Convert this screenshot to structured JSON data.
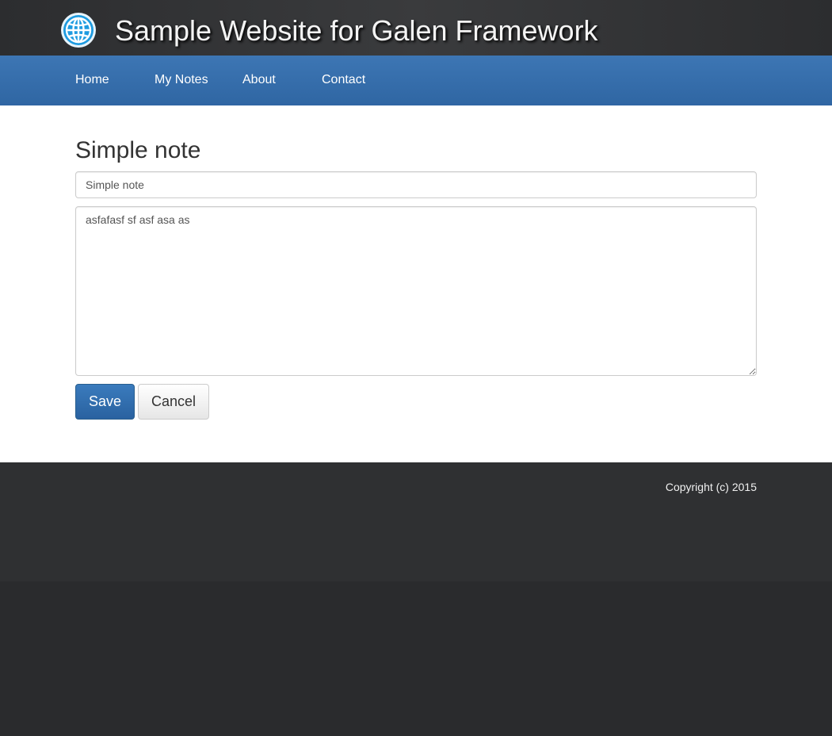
{
  "header": {
    "title": "Sample Website for Galen Framework",
    "logo_icon": "globe-icon"
  },
  "nav": {
    "items": [
      {
        "label": "Home"
      },
      {
        "label": "My Notes"
      },
      {
        "label": "About"
      },
      {
        "label": "Contact"
      }
    ]
  },
  "main": {
    "page_title": "Simple note",
    "title_field": {
      "value": "Simple note"
    },
    "body_field": {
      "value": "asfafasf sf asf asa as"
    },
    "save_label": "Save",
    "cancel_label": "Cancel"
  },
  "footer": {
    "copyright": "Copyright (c) 2015"
  },
  "colors": {
    "navbar": "#3572b0",
    "save_button": "#3071a9",
    "header_bg": "#323335",
    "footer_bg": "#2f3032"
  }
}
